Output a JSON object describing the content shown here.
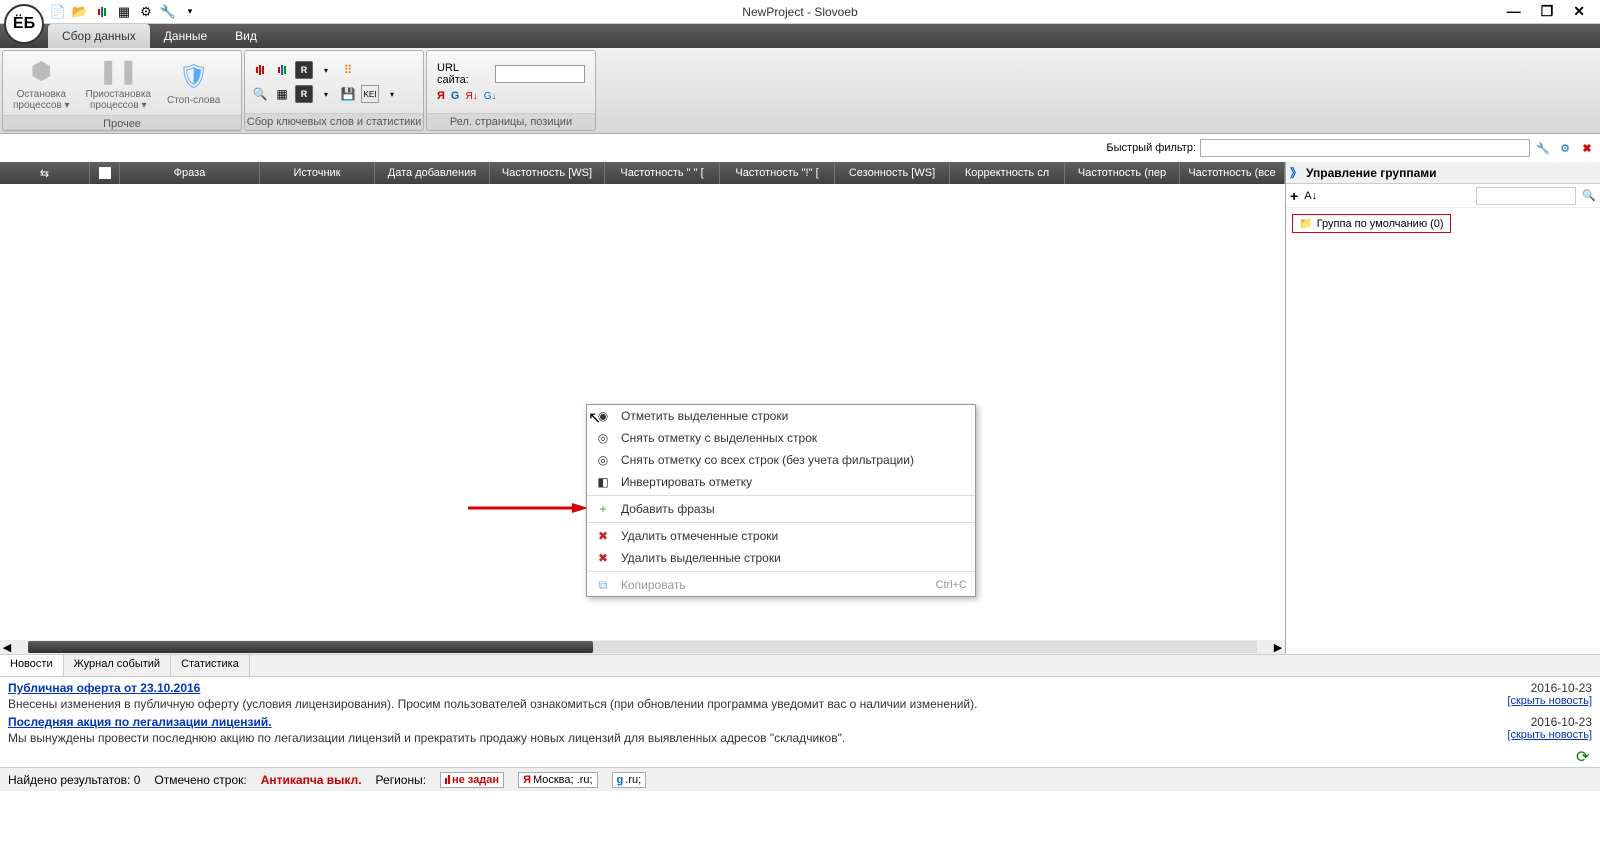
{
  "title": "NewProject - Slovoeb",
  "logo": "ЁБ",
  "tabs": [
    "Сбор данных",
    "Данные",
    "Вид"
  ],
  "ribbon": {
    "group1": {
      "btn1": "Остановка\nпроцессов ▾",
      "btn2": "Приостановка\nпроцессов ▾",
      "btn3": "Стоп-слова",
      "label": "Прочее"
    },
    "group2": {
      "label": "Сбор ключевых слов и статистики"
    },
    "group3": {
      "url_label": "URL сайта:",
      "label": "Рел. страницы, позиции"
    }
  },
  "filter_label": "Быстрый фильтр:",
  "columns": [
    "",
    "",
    "Фраза",
    "Источник",
    "Дата добавления",
    "Частотность [WS]",
    "Частотность \" \" [",
    "Частотность \"!\" [",
    "Сезонность [WS]",
    "Корректность сл",
    "Частотность (пер",
    "Частотность (все"
  ],
  "right_panel": {
    "title": "Управление группами",
    "node": "Группа по умолчанию (0)"
  },
  "context_menu": {
    "items": [
      {
        "icon": "◉",
        "label": "Отметить выделенные строки",
        "disabled": false
      },
      {
        "icon": "◎",
        "label": "Снять отметку с выделенных строк",
        "disabled": false
      },
      {
        "icon": "◎",
        "label": "Снять отметку со всех строк (без учета фильтрации)",
        "disabled": false
      },
      {
        "icon": "◧",
        "label": "Инвертировать отметку",
        "disabled": false
      },
      {
        "sep": true
      },
      {
        "icon": "+",
        "iconColor": "#2a2",
        "label": "Добавить фразы",
        "disabled": false
      },
      {
        "sep": true
      },
      {
        "icon": "✖",
        "iconColor": "#c22",
        "label": "Удалить отмеченные строки",
        "disabled": false
      },
      {
        "icon": "✖",
        "iconColor": "#c22",
        "label": "Удалить выделенные строки",
        "disabled": false
      },
      {
        "sep": true
      },
      {
        "icon": "⧉",
        "iconColor": "#6af",
        "label": "Копировать",
        "shortcut": "Ctrl+C",
        "disabled": true
      }
    ]
  },
  "bottom_tabs": [
    "Новости",
    "Журнал событий",
    "Статистика"
  ],
  "news": [
    {
      "title": "Публичная оферта от 23.10.2016",
      "date": "2016-10-23",
      "hide": "[скрыть новость]",
      "body": "Внесены изменения в публичную оферту (условия лицензирования). Просим пользователей ознакомиться (при обновлении программа уведомит вас о наличии изменений)."
    },
    {
      "title": "Последняя акция по легализации лицензий.",
      "date": "2016-10-23",
      "hide": "[скрыть новость]",
      "body": "Мы вынуждены провести последнюю акцию по легализации лицензий и прекратить продажу новых лицензий для выявленных адресов \"складчиков\"."
    }
  ],
  "status": {
    "results": "Найдено результатов:  0",
    "marked": "Отмечено строк:",
    "anticaptcha": "Антикапча выкл.",
    "regions_label": "Регионы:",
    "region1": "не задан",
    "region2": "Москва; .ru;",
    "region3": ".ru;"
  }
}
